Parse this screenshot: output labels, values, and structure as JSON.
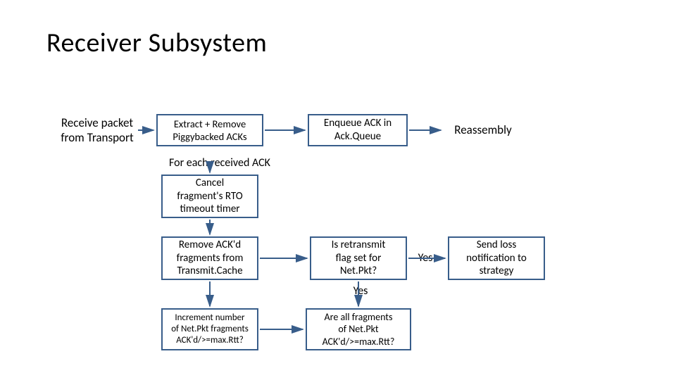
{
  "title": "Receiver Subsystem",
  "labels": {
    "receive_packet": "Receive packet\nfrom Transport",
    "for_each_ack": "For each received ACK",
    "reassembly": "Reassembly",
    "yes_right": "Yes",
    "yes_below": "Yes"
  },
  "boxes": {
    "extract": "Extract + Remove\nPiggybacked ACKs",
    "enqueue": "Enqueue ACK in\nAck.Queue",
    "cancel_rto": "Cancel\nfragment's RTO\ntimeout timer",
    "remove_ackd": "Remove ACK'd\nfragments from\nTransmit.Cache",
    "increment": "Increment number\nof Net.Pkt fragments\nACK'd/>=max.Rtt?",
    "is_retransmit": "Is retransmit\nflag set for\nNet.Pkt?",
    "all_fragments": "Are all fragments\nof Net.Pkt\nACK'd/>=max.Rtt?",
    "send_loss": "Send loss\nnotification to\nstrategy"
  }
}
